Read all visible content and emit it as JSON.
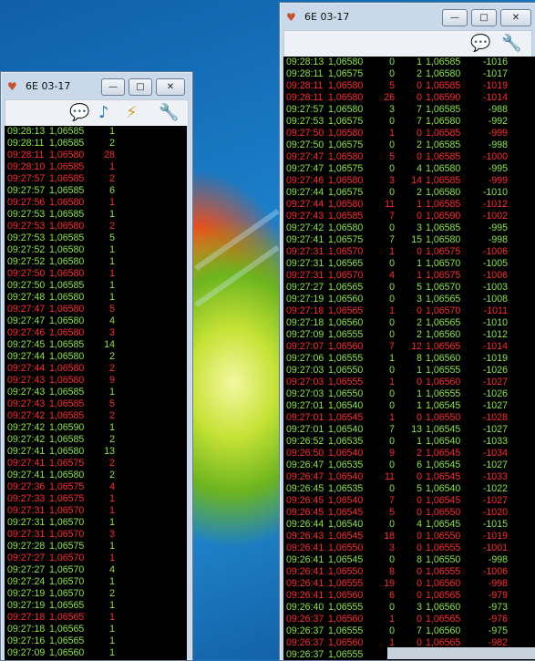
{
  "left_window": {
    "title": "6E 03-17",
    "toolbar_icons": [
      "chat-icon",
      "music-icon",
      "plug-icon",
      "wrench-icon"
    ],
    "rows": [
      {
        "time": "09:28:13",
        "price": "1,06585",
        "vol": "1",
        "dir": "up"
      },
      {
        "time": "09:28:11",
        "price": "1,06585",
        "vol": "2",
        "dir": "up"
      },
      {
        "time": "09:28:11",
        "price": "1,06580",
        "vol": "28",
        "dir": "dn"
      },
      {
        "time": "09:28:10",
        "price": "1,06585",
        "vol": "1",
        "dir": "dn"
      },
      {
        "time": "09:27:57",
        "price": "1,06585",
        "vol": "2",
        "dir": "dn"
      },
      {
        "time": "09:27:57",
        "price": "1,06585",
        "vol": "6",
        "dir": "up"
      },
      {
        "time": "09:27:56",
        "price": "1,06580",
        "vol": "1",
        "dir": "dn"
      },
      {
        "time": "09:27:53",
        "price": "1,06585",
        "vol": "1",
        "dir": "up"
      },
      {
        "time": "09:27:53",
        "price": "1,06580",
        "vol": "2",
        "dir": "dn"
      },
      {
        "time": "09:27:53",
        "price": "1,06585",
        "vol": "5",
        "dir": "up"
      },
      {
        "time": "09:27:52",
        "price": "1,06580",
        "vol": "1",
        "dir": "up"
      },
      {
        "time": "09:27:52",
        "price": "1,06580",
        "vol": "1",
        "dir": "up"
      },
      {
        "time": "09:27:50",
        "price": "1,06580",
        "vol": "1",
        "dir": "dn"
      },
      {
        "time": "09:27:50",
        "price": "1,06585",
        "vol": "1",
        "dir": "up"
      },
      {
        "time": "09:27:48",
        "price": "1,06580",
        "vol": "1",
        "dir": "up"
      },
      {
        "time": "09:27:47",
        "price": "1,06580",
        "vol": "5",
        "dir": "dn"
      },
      {
        "time": "09:27:47",
        "price": "1,06580",
        "vol": "4",
        "dir": "up"
      },
      {
        "time": "09:27:46",
        "price": "1,06580",
        "vol": "3",
        "dir": "dn"
      },
      {
        "time": "09:27:45",
        "price": "1,06585",
        "vol": "14",
        "dir": "up"
      },
      {
        "time": "09:27:44",
        "price": "1,06580",
        "vol": "2",
        "dir": "up"
      },
      {
        "time": "09:27:44",
        "price": "1,06580",
        "vol": "2",
        "dir": "dn"
      },
      {
        "time": "09:27:43",
        "price": "1,06580",
        "vol": "9",
        "dir": "dn"
      },
      {
        "time": "09:27:43",
        "price": "1,06585",
        "vol": "1",
        "dir": "up"
      },
      {
        "time": "09:27:43",
        "price": "1,06585",
        "vol": "5",
        "dir": "dn"
      },
      {
        "time": "09:27:42",
        "price": "1,06585",
        "vol": "2",
        "dir": "dn"
      },
      {
        "time": "09:27:42",
        "price": "1,06590",
        "vol": "1",
        "dir": "up"
      },
      {
        "time": "09:27:42",
        "price": "1,06585",
        "vol": "2",
        "dir": "up"
      },
      {
        "time": "09:27:41",
        "price": "1,06580",
        "vol": "13",
        "dir": "up"
      },
      {
        "time": "09:27:41",
        "price": "1,06575",
        "vol": "2",
        "dir": "dn"
      },
      {
        "time": "09:27:41",
        "price": "1,06580",
        "vol": "2",
        "dir": "up"
      },
      {
        "time": "09:27:36",
        "price": "1,06575",
        "vol": "4",
        "dir": "dn"
      },
      {
        "time": "09:27:33",
        "price": "1,06575",
        "vol": "1",
        "dir": "dn"
      },
      {
        "time": "09:27:31",
        "price": "1,06570",
        "vol": "1",
        "dir": "dn"
      },
      {
        "time": "09:27:31",
        "price": "1,06570",
        "vol": "1",
        "dir": "up"
      },
      {
        "time": "09:27:31",
        "price": "1,06570",
        "vol": "3",
        "dir": "dn"
      },
      {
        "time": "09:27:28",
        "price": "1,06575",
        "vol": "1",
        "dir": "up"
      },
      {
        "time": "09:27:27",
        "price": "1,06570",
        "vol": "1",
        "dir": "dn"
      },
      {
        "time": "09:27:27",
        "price": "1,06570",
        "vol": "4",
        "dir": "up"
      },
      {
        "time": "09:27:24",
        "price": "1,06570",
        "vol": "1",
        "dir": "up"
      },
      {
        "time": "09:27:19",
        "price": "1,06570",
        "vol": "2",
        "dir": "up"
      },
      {
        "time": "09:27:19",
        "price": "1,06565",
        "vol": "1",
        "dir": "up"
      },
      {
        "time": "09:27:18",
        "price": "1,06565",
        "vol": "1",
        "dir": "dn"
      },
      {
        "time": "09:27:18",
        "price": "1,06565",
        "vol": "1",
        "dir": "up"
      },
      {
        "time": "09:27:16",
        "price": "1,06565",
        "vol": "1",
        "dir": "up"
      },
      {
        "time": "09:27:09",
        "price": "1,06560",
        "vol": "1",
        "dir": "up"
      }
    ]
  },
  "right_window": {
    "title": "6E 03-17",
    "toolbar_icons": [
      "chat-icon",
      "wrench-icon"
    ],
    "rows": [
      {
        "time": "09:28:13",
        "price": "1,06580",
        "a": "0",
        "b": "1",
        "bid": "1,06585",
        "delta": "-1016",
        "dir": "up"
      },
      {
        "time": "09:28:11",
        "price": "1,06575",
        "a": "0",
        "b": "2",
        "bid": "1,06580",
        "delta": "-1017",
        "dir": "up"
      },
      {
        "time": "09:28:11",
        "price": "1,06580",
        "a": "5",
        "b": "0",
        "bid": "1,06585",
        "delta": "-1019",
        "dir": "dn"
      },
      {
        "time": "09:28:11",
        "price": "1,06580",
        "a": "26",
        "b": "0",
        "bid": "1,06590",
        "delta": "-1014",
        "dir": "dn"
      },
      {
        "time": "09:27:57",
        "price": "1,06580",
        "a": "3",
        "b": "7",
        "bid": "1,06585",
        "delta": "-988",
        "dir": "up"
      },
      {
        "time": "09:27:53",
        "price": "1,06575",
        "a": "0",
        "b": "7",
        "bid": "1,06580",
        "delta": "-992",
        "dir": "up"
      },
      {
        "time": "09:27:50",
        "price": "1,06580",
        "a": "1",
        "b": "0",
        "bid": "1,06585",
        "delta": "-999",
        "dir": "dn"
      },
      {
        "time": "09:27:50",
        "price": "1,06575",
        "a": "0",
        "b": "2",
        "bid": "1,06585",
        "delta": "-998",
        "dir": "up"
      },
      {
        "time": "09:27:47",
        "price": "1,06580",
        "a": "5",
        "b": "0",
        "bid": "1,06585",
        "delta": "-1000",
        "dir": "dn"
      },
      {
        "time": "09:27:47",
        "price": "1,06575",
        "a": "0",
        "b": "4",
        "bid": "1,06580",
        "delta": "-995",
        "dir": "up"
      },
      {
        "time": "09:27:46",
        "price": "1,06580",
        "a": "3",
        "b": "14",
        "bid": "1,06585",
        "delta": "-999",
        "dir": "dn"
      },
      {
        "time": "09:27:44",
        "price": "1,06575",
        "a": "0",
        "b": "2",
        "bid": "1,06580",
        "delta": "-1010",
        "dir": "up"
      },
      {
        "time": "09:27:44",
        "price": "1,06580",
        "a": "11",
        "b": "1",
        "bid": "1,06585",
        "delta": "-1012",
        "dir": "dn"
      },
      {
        "time": "09:27:43",
        "price": "1,06585",
        "a": "7",
        "b": "0",
        "bid": "1,06590",
        "delta": "-1002",
        "dir": "dn"
      },
      {
        "time": "09:27:42",
        "price": "1,06580",
        "a": "0",
        "b": "3",
        "bid": "1,06585",
        "delta": "-995",
        "dir": "up"
      },
      {
        "time": "09:27:41",
        "price": "1,06575",
        "a": "7",
        "b": "15",
        "bid": "1,06580",
        "delta": "-998",
        "dir": "up"
      },
      {
        "time": "09:27:31",
        "price": "1,06570",
        "a": "1",
        "b": "0",
        "bid": "1,06575",
        "delta": "-1006",
        "dir": "dn"
      },
      {
        "time": "09:27:31",
        "price": "1,06565",
        "a": "0",
        "b": "1",
        "bid": "1,06570",
        "delta": "-1005",
        "dir": "up"
      },
      {
        "time": "09:27:31",
        "price": "1,06570",
        "a": "4",
        "b": "1",
        "bid": "1,06575",
        "delta": "-1006",
        "dir": "dn"
      },
      {
        "time": "09:27:27",
        "price": "1,06565",
        "a": "0",
        "b": "5",
        "bid": "1,06570",
        "delta": "-1003",
        "dir": "up"
      },
      {
        "time": "09:27:19",
        "price": "1,06560",
        "a": "0",
        "b": "3",
        "bid": "1,06565",
        "delta": "-1008",
        "dir": "up"
      },
      {
        "time": "09:27:18",
        "price": "1,06565",
        "a": "1",
        "b": "0",
        "bid": "1,06570",
        "delta": "-1011",
        "dir": "dn"
      },
      {
        "time": "09:27:18",
        "price": "1,06560",
        "a": "0",
        "b": "2",
        "bid": "1,06565",
        "delta": "-1010",
        "dir": "up"
      },
      {
        "time": "09:27:09",
        "price": "1,06555",
        "a": "0",
        "b": "2",
        "bid": "1,06560",
        "delta": "-1012",
        "dir": "up"
      },
      {
        "time": "09:27:07",
        "price": "1,06560",
        "a": "7",
        "b": "12",
        "bid": "1,06565",
        "delta": "-1014",
        "dir": "dn"
      },
      {
        "time": "09:27:06",
        "price": "1,06555",
        "a": "1",
        "b": "8",
        "bid": "1,06560",
        "delta": "-1019",
        "dir": "up"
      },
      {
        "time": "09:27:03",
        "price": "1,06550",
        "a": "0",
        "b": "1",
        "bid": "1,06555",
        "delta": "-1026",
        "dir": "up"
      },
      {
        "time": "09:27:03",
        "price": "1,06555",
        "a": "1",
        "b": "0",
        "bid": "1,06560",
        "delta": "-1027",
        "dir": "dn"
      },
      {
        "time": "09:27:03",
        "price": "1,06550",
        "a": "0",
        "b": "1",
        "bid": "1,06555",
        "delta": "-1026",
        "dir": "up"
      },
      {
        "time": "09:27:01",
        "price": "1,06540",
        "a": "0",
        "b": "1",
        "bid": "1,06545",
        "delta": "-1027",
        "dir": "up"
      },
      {
        "time": "09:27:01",
        "price": "1,06545",
        "a": "1",
        "b": "0",
        "bid": "1,06550",
        "delta": "-1028",
        "dir": "dn"
      },
      {
        "time": "09:27:01",
        "price": "1,06540",
        "a": "7",
        "b": "13",
        "bid": "1,06545",
        "delta": "-1027",
        "dir": "up"
      },
      {
        "time": "09:26:52",
        "price": "1,06535",
        "a": "0",
        "b": "1",
        "bid": "1,06540",
        "delta": "-1033",
        "dir": "up"
      },
      {
        "time": "09:26:50",
        "price": "1,06540",
        "a": "9",
        "b": "2",
        "bid": "1,06545",
        "delta": "-1034",
        "dir": "dn"
      },
      {
        "time": "09:26:47",
        "price": "1,06535",
        "a": "0",
        "b": "6",
        "bid": "1,06545",
        "delta": "-1027",
        "dir": "up"
      },
      {
        "time": "09:26:47",
        "price": "1,06540",
        "a": "11",
        "b": "0",
        "bid": "1,06545",
        "delta": "-1033",
        "dir": "dn"
      },
      {
        "time": "09:26:45",
        "price": "1,06535",
        "a": "0",
        "b": "5",
        "bid": "1,06540",
        "delta": "-1022",
        "dir": "up"
      },
      {
        "time": "09:26:45",
        "price": "1,06540",
        "a": "7",
        "b": "0",
        "bid": "1,06545",
        "delta": "-1027",
        "dir": "dn"
      },
      {
        "time": "09:26:45",
        "price": "1,06545",
        "a": "5",
        "b": "0",
        "bid": "1,06550",
        "delta": "-1020",
        "dir": "dn"
      },
      {
        "time": "09:26:44",
        "price": "1,06540",
        "a": "0",
        "b": "4",
        "bid": "1,06545",
        "delta": "-1015",
        "dir": "up"
      },
      {
        "time": "09:26:43",
        "price": "1,06545",
        "a": "18",
        "b": "0",
        "bid": "1,06550",
        "delta": "-1019",
        "dir": "dn"
      },
      {
        "time": "09:26:41",
        "price": "1,06550",
        "a": "3",
        "b": "0",
        "bid": "1,06555",
        "delta": "-1001",
        "dir": "dn"
      },
      {
        "time": "09:26:41",
        "price": "1,06545",
        "a": "0",
        "b": "8",
        "bid": "1,06550",
        "delta": "-998",
        "dir": "up"
      },
      {
        "time": "09:26:41",
        "price": "1,06550",
        "a": "8",
        "b": "0",
        "bid": "1,06555",
        "delta": "-1006",
        "dir": "dn"
      },
      {
        "time": "09:26:41",
        "price": "1,06555",
        "a": "19",
        "b": "0",
        "bid": "1,06560",
        "delta": "-998",
        "dir": "dn"
      },
      {
        "time": "09:26:41",
        "price": "1,06560",
        "a": "6",
        "b": "0",
        "bid": "1,06565",
        "delta": "-979",
        "dir": "dn"
      },
      {
        "time": "09:26:40",
        "price": "1,06555",
        "a": "0",
        "b": "3",
        "bid": "1,06560",
        "delta": "-973",
        "dir": "up"
      },
      {
        "time": "09:26:37",
        "price": "1,06560",
        "a": "1",
        "b": "0",
        "bid": "1,06565",
        "delta": "-976",
        "dir": "dn"
      },
      {
        "time": "09:26:37",
        "price": "1,06555",
        "a": "0",
        "b": "7",
        "bid": "1,06560",
        "delta": "-975",
        "dir": "up"
      },
      {
        "time": "09:26:37",
        "price": "1,06560",
        "a": "1",
        "b": "0",
        "bid": "1,06565",
        "delta": "-982",
        "dir": "dn"
      },
      {
        "time": "09:26:37",
        "price": "1,06555",
        "a": "",
        "b": "",
        "bid": "",
        "delta": "",
        "dir": "up"
      }
    ]
  },
  "colors": {
    "up": "#8ce63a",
    "down": "#ff2b2b",
    "grid_bg": "#000000",
    "window_frame": "#c9d9ea"
  }
}
